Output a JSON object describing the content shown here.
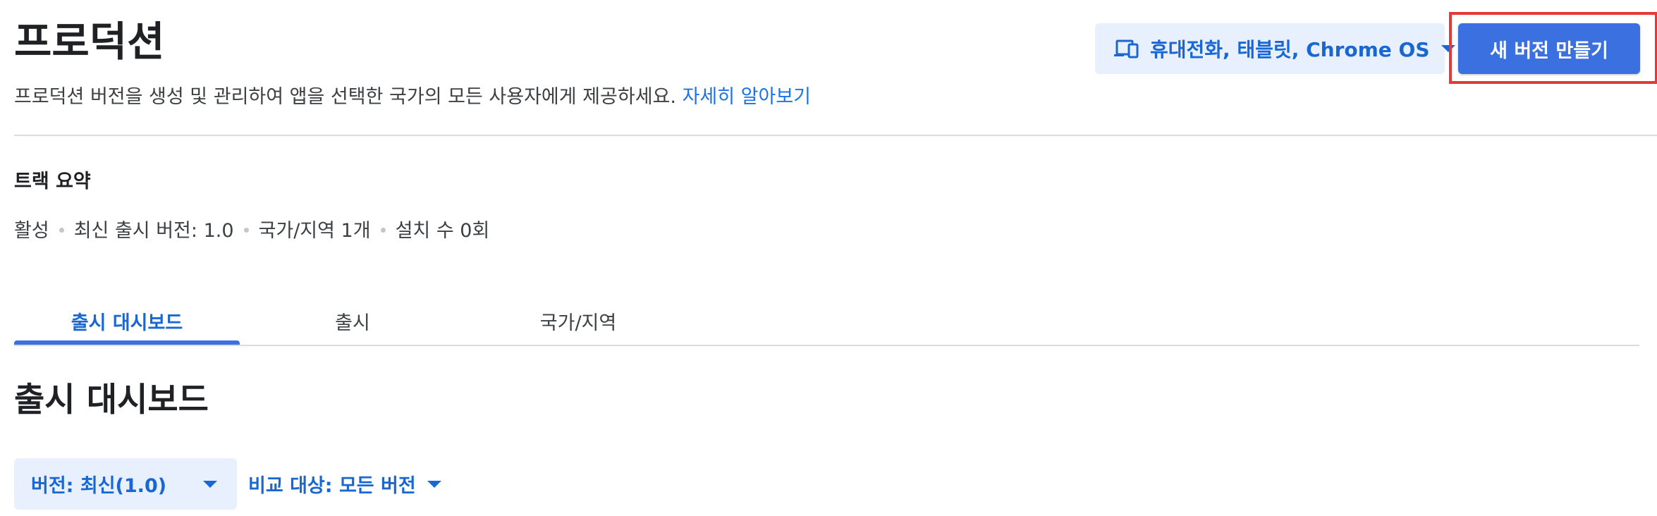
{
  "header": {
    "title": "프로덕션",
    "subtitle": "프로덕션 버전을 생성 및 관리하여 앱을 선택한 국가의 모든 사용자에게 제공하세요.",
    "learn_more": "자세히 알아보기",
    "device_selector": {
      "label": "휴대전화, 태블릿, Chrome OS",
      "icon": "devices-icon"
    },
    "create_button": "새 버전 만들기"
  },
  "track_summary": {
    "heading": "트랙 요약",
    "status": "활성",
    "latest_release": "최신 출시 버전: 1.0",
    "countries": "국가/지역 1개",
    "installs": "설치 수 0회"
  },
  "tabs": [
    {
      "label": "출시 대시보드",
      "active": true
    },
    {
      "label": "출시",
      "active": false
    },
    {
      "label": "국가/지역",
      "active": false
    }
  ],
  "dashboard": {
    "heading": "출시 대시보드",
    "version_filter": "버전: 최신(1.0)",
    "compare_filter": "비교 대상: 모든 버전"
  },
  "colors": {
    "accent": "#1967d2",
    "primary_button": "#3b70e0",
    "chip_background": "#e8f0fe",
    "highlight": "#e53935"
  }
}
